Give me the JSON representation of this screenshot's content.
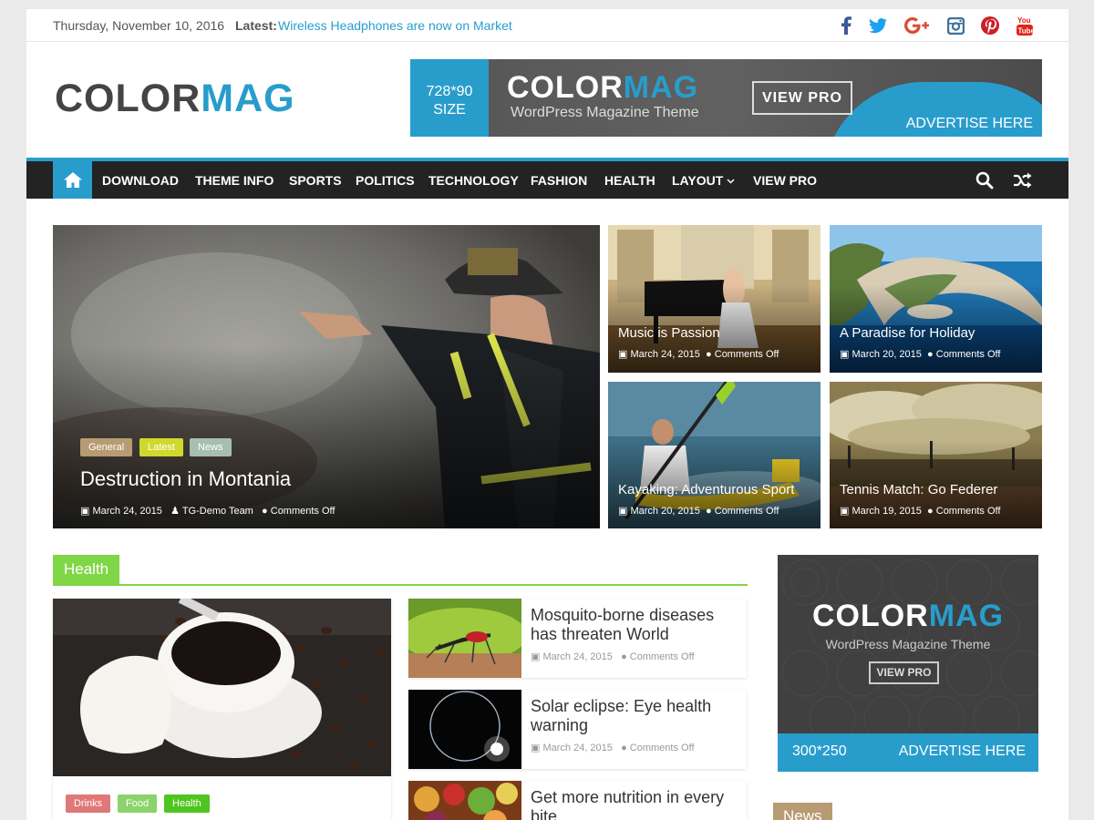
{
  "topbar": {
    "date": "Thursday, November 10, 2016",
    "latest_label": "Latest:",
    "latest_link": "Wireless Headphones are now on Market",
    "social_icons": [
      "facebook-icon",
      "twitter-icon",
      "google-plus-icon",
      "instagram-icon",
      "pinterest-icon",
      "youtube-icon"
    ]
  },
  "header": {
    "logo_dark": "COLOR",
    "logo_blue": "MAG",
    "ad": {
      "size_line1": "728*90",
      "size_line2": "SIZE",
      "brand_dark": "COLOR",
      "brand_blue": "MAG",
      "tagline": "WordPress Magazine Theme",
      "button": "VIEW PRO",
      "advertise": "ADVERTISE HERE"
    }
  },
  "nav": {
    "items": [
      "DOWNLOAD",
      "THEME INFO",
      "SPORTS",
      "POLITICS",
      "TECHNOLOGY",
      "FASHION",
      "HEALTH",
      "LAYOUT",
      "VIEW PRO"
    ],
    "accent": "#289dcc"
  },
  "featured": {
    "main": {
      "categories": [
        "General",
        "Latest",
        "News"
      ],
      "title": "Destruction in Montania",
      "date": "March 24, 2015",
      "author": "TG-Demo Team",
      "comments": "Comments Off"
    },
    "grid": [
      {
        "title": "Music is Passion",
        "date": "March 24, 2015",
        "comments": "Comments Off"
      },
      {
        "title": "A Paradise for Holiday",
        "date": "March 20, 2015",
        "comments": "Comments Off"
      },
      {
        "title": "Kayaking: Adventurous Sport",
        "date": "March 20, 2015",
        "comments": "Comments Off"
      },
      {
        "title": "Tennis Match: Go Federer",
        "date": "March 19, 2015",
        "comments": "Comments Off"
      }
    ]
  },
  "health": {
    "heading": "Health",
    "main_categories": [
      "Drinks",
      "Food",
      "Health"
    ],
    "posts": [
      {
        "title": "Mosquito-borne diseases has threaten World",
        "date": "March 24, 2015",
        "comments": "Comments Off"
      },
      {
        "title": "Solar eclipse: Eye health warning",
        "date": "March 24, 2015",
        "comments": "Comments Off"
      },
      {
        "title": "Get more nutrition in every bite",
        "date": "",
        "comments": ""
      }
    ],
    "accent": "#7fd646"
  },
  "sidebar": {
    "ad": {
      "brand_dark": "COLOR",
      "brand_blue": "MAG",
      "tagline": "WordPress Magazine Theme",
      "button": "VIEW PRO",
      "size": "300*250",
      "advertise": "ADVERTISE HERE"
    },
    "news_heading": "News"
  }
}
